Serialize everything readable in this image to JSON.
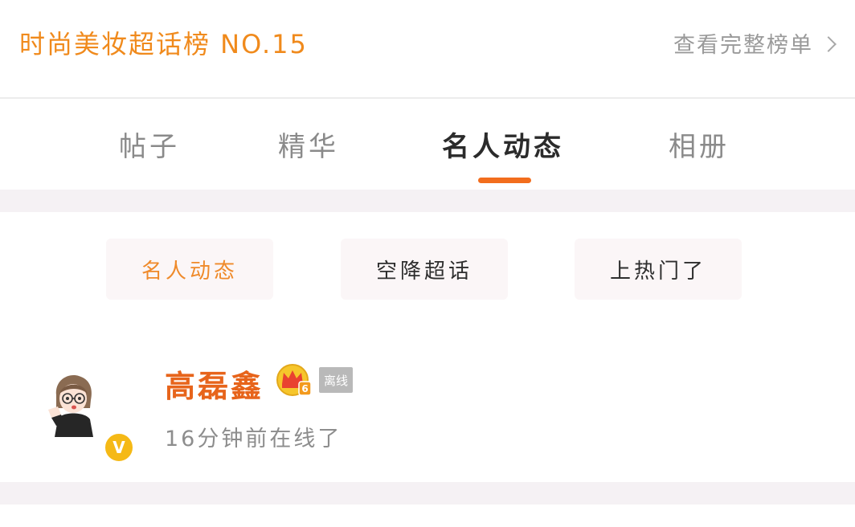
{
  "header": {
    "rank_title": "时尚美妆超话榜 NO.15",
    "view_all_label": "查看完整榜单"
  },
  "tabs": [
    {
      "label": "帖子",
      "active": false
    },
    {
      "label": "精华",
      "active": false
    },
    {
      "label": "名人动态",
      "active": true
    },
    {
      "label": "相册",
      "active": false
    }
  ],
  "subtabs": [
    {
      "label": "名人动态",
      "active": true
    },
    {
      "label": "空降超话",
      "active": false
    },
    {
      "label": "上热门了",
      "active": false
    }
  ],
  "user": {
    "name": "高磊鑫",
    "level_badge": "6",
    "status_badge": "离线",
    "verified_icon": "V",
    "online_time": "16分钟前在线了"
  },
  "colors": {
    "accent": "#f08a1c",
    "tab_indicator": "#f26d1d",
    "username": "#e7641b",
    "separator_band": "#f5f1f4",
    "chip_bg": "#fbf6f7",
    "verified_badge": "#f5b916"
  },
  "icons": {
    "view_all_arrow": "chevron-right-icon",
    "verified": "verified-v-icon",
    "level": "crown-icon"
  }
}
